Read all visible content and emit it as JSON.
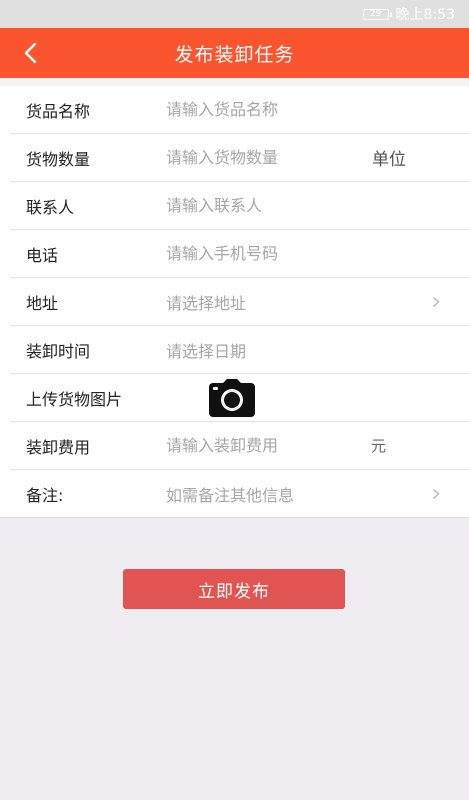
{
  "status_bar": {
    "battery": "29",
    "time": "晚上8:53"
  },
  "header": {
    "title": "发布装卸任务",
    "back_icon": "chevron-left-icon",
    "background_color": "#fb5530"
  },
  "form": {
    "goods_name": {
      "label": "货品名称",
      "placeholder": "请输入货品名称"
    },
    "goods_quantity": {
      "label": "货物数量",
      "placeholder": "请输入货物数量",
      "unit": "单位"
    },
    "contact": {
      "label": "联系人",
      "placeholder": "请输入联系人"
    },
    "phone": {
      "label": "电话",
      "placeholder": "请输入手机号码"
    },
    "address": {
      "label": "地址",
      "placeholder": "请选择地址"
    },
    "time": {
      "label": "装卸时间",
      "placeholder": "请选择日期"
    },
    "photo": {
      "label": "上传货物图片",
      "icon": "camera-icon"
    },
    "fee": {
      "label": "装卸费用",
      "placeholder": "请输入装卸费用",
      "unit": "元"
    },
    "remark": {
      "label": "备注:",
      "placeholder": "如需备注其他信息"
    }
  },
  "actions": {
    "publish_label": "立即发布",
    "publish_color": "#e05552"
  }
}
